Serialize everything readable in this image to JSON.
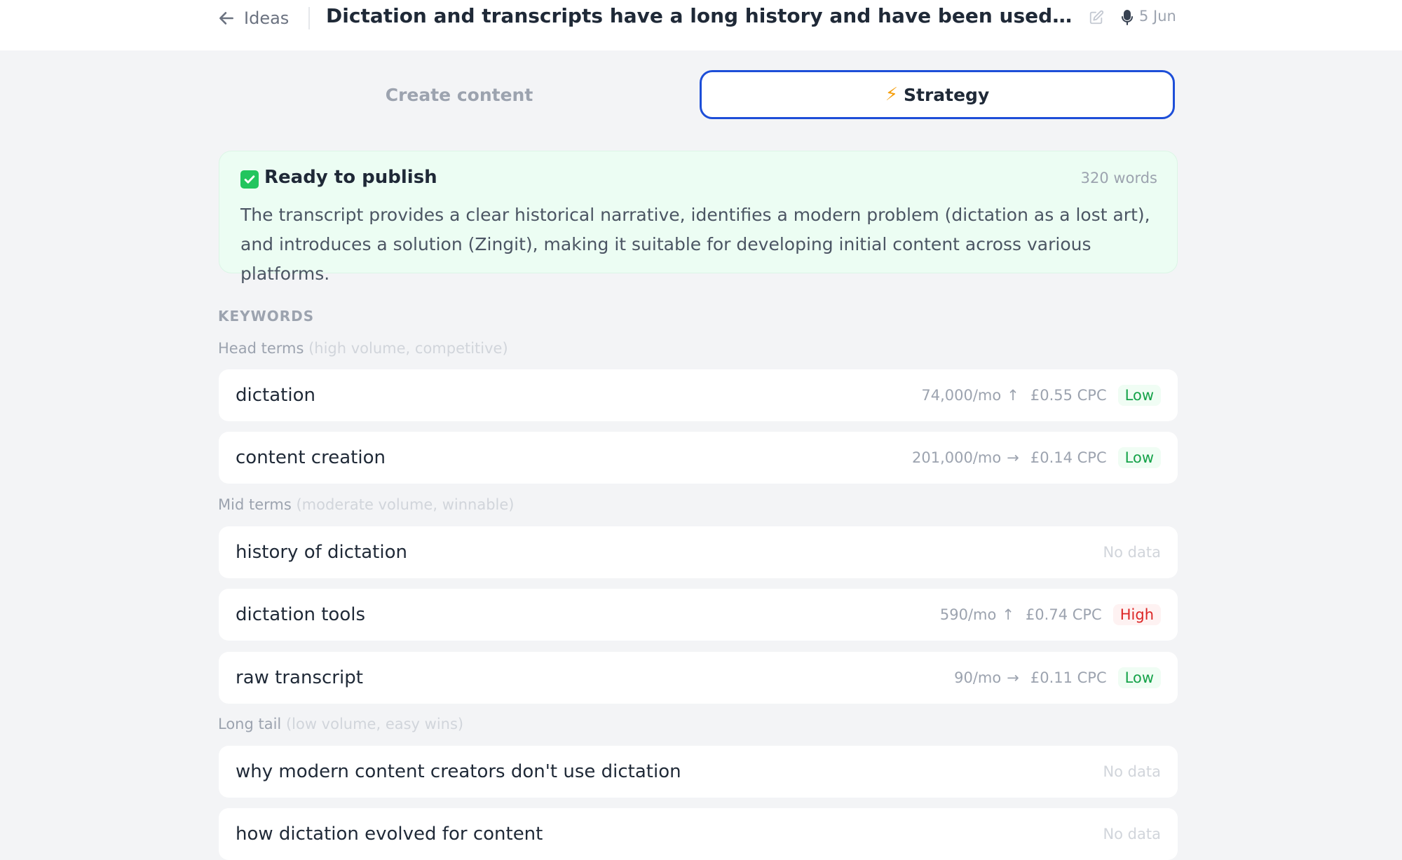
{
  "header": {
    "back_label": "Ideas",
    "title": "Dictation and transcripts have a long history and have been used a lot over the centuries by writers and creators",
    "date": "5 Jun"
  },
  "tabs": [
    {
      "label": "Create content",
      "active": false
    },
    {
      "label": "Strategy",
      "active": true,
      "icon": "lightning-icon"
    }
  ],
  "status": {
    "icon": "check-icon",
    "title": "Ready to publish",
    "word_count": "320 words",
    "description": "The transcript provides a clear historical narrative, identifies a modern problem (dictation as a lost art), and introduces a solution (Zingit), making it suitable for developing initial content across various platforms."
  },
  "keywords": {
    "heading": "KEYWORDS",
    "groups": [
      {
        "label": "Head terms",
        "hint": "(high volume, competitive)",
        "items": [
          {
            "term": "dictation",
            "volume": "74,000/mo",
            "trend": "↑",
            "cpc": "£0.55 CPC",
            "competition": "Low"
          },
          {
            "term": "content creation",
            "volume": "201,000/mo",
            "trend": "→",
            "cpc": "£0.14 CPC",
            "competition": "Low"
          }
        ]
      },
      {
        "label": "Mid terms",
        "hint": "(moderate volume, winnable)",
        "items": [
          {
            "term": "history of dictation",
            "nodata": "No data"
          },
          {
            "term": "dictation tools",
            "volume": "590/mo",
            "trend": "↑",
            "cpc": "£0.74 CPC",
            "competition": "High"
          },
          {
            "term": "raw transcript",
            "volume": "90/mo",
            "trend": "→",
            "cpc": "£0.11 CPC",
            "competition": "Low"
          }
        ]
      },
      {
        "label": "Long tail",
        "hint": "(low volume, easy wins)",
        "items": [
          {
            "term": "why modern content creators don't use dictation",
            "nodata": "No data"
          },
          {
            "term": "how dictation evolved for content",
            "nodata": "No data"
          }
        ]
      }
    ]
  },
  "colors": {
    "accent": "#1d4ed8",
    "success_bg": "#ecfdf3",
    "low": "#16a34a",
    "high": "#dc2626"
  }
}
